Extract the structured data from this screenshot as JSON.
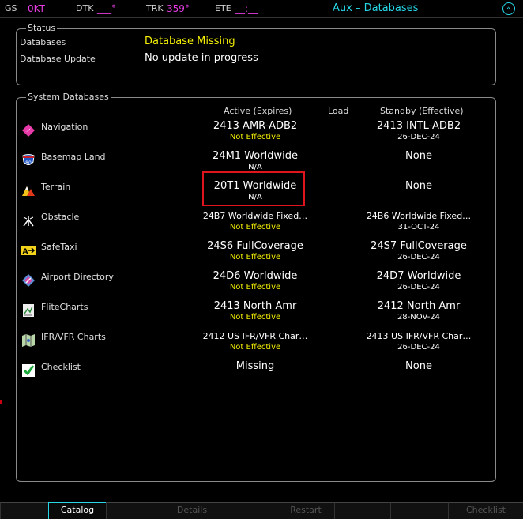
{
  "topbar": {
    "gs_label": "GS",
    "gs_value": "0KT",
    "dtk_label": "DTK",
    "dtk_value": "___°",
    "trk_label": "TRK",
    "trk_value": "359°",
    "ete_label": "ETE",
    "ete_value": "__:__",
    "page_title": "Aux – Databases",
    "home_icon": "home-icon"
  },
  "status": {
    "legend": "Status",
    "rows": [
      {
        "label": "Databases",
        "value": "Database Missing",
        "value_color": "#f4f000"
      },
      {
        "label": "Database Update",
        "value": "No update in progress",
        "value_color": "#ffffff"
      }
    ]
  },
  "system": {
    "legend": "System Databases",
    "col_active": "Active (Expires)",
    "col_load": "Load",
    "col_standby": "Standby (Effective)",
    "rows": [
      {
        "name": "Navigation",
        "icon": "navigation-icon",
        "active": "2413 AMR-ADB2",
        "active_sub": "Not Effective",
        "standby": "2413 INTL-ADB2",
        "standby_sub": "26-DEC-24"
      },
      {
        "name": "Basemap Land",
        "icon": "interstate-shield-icon",
        "active": "24M1 Worldwide",
        "active_sub": "N/A",
        "standby": "None",
        "standby_sub": ""
      },
      {
        "name": "Terrain",
        "icon": "terrain-icon",
        "active": "20T1 Worldwide",
        "active_sub": "N/A",
        "standby": "None",
        "standby_sub": ""
      },
      {
        "name": "Obstacle",
        "icon": "obstacle-icon",
        "active": "24B7 Worldwide Fixed…",
        "active_sub": "Not Effective",
        "standby": "24B6 Worldwide Fixed…",
        "standby_sub": "31-OCT-24"
      },
      {
        "name": "SafeTaxi",
        "icon": "safetaxi-icon",
        "active": "24S6 FullCoverage",
        "active_sub": "Not Effective",
        "standby": "24S7 FullCoverage",
        "standby_sub": "26-DEC-24"
      },
      {
        "name": "Airport Directory",
        "icon": "airport-directory-icon",
        "active": "24D6 Worldwide",
        "active_sub": "Not Effective",
        "standby": "24D7 Worldwide",
        "standby_sub": "26-DEC-24"
      },
      {
        "name": "FliteCharts",
        "icon": "flitecharts-icon",
        "active": "2413 North Amr",
        "active_sub": "Not Effective",
        "standby": "2412 North Amr",
        "standby_sub": "28-NOV-24"
      },
      {
        "name": "IFR/VFR Charts",
        "icon": "ifr-vfr-charts-icon",
        "active": "2412 US IFR/VFR Char…",
        "active_sub": "Not Effective",
        "standby": "2413 US IFR/VFR Char…",
        "standby_sub": "26-DEC-24"
      },
      {
        "name": "Checklist",
        "icon": "checklist-icon",
        "active": "Missing",
        "active_sub": "",
        "standby": "None",
        "standby_sub": ""
      }
    ]
  },
  "softkeys": [
    "Catalog",
    "Details",
    "Restart",
    "Checklist"
  ],
  "colors": {
    "accent": "#27d7e8",
    "warning": "#f4f000",
    "magenta": "#e53be0",
    "highlight": "#e0141c"
  }
}
